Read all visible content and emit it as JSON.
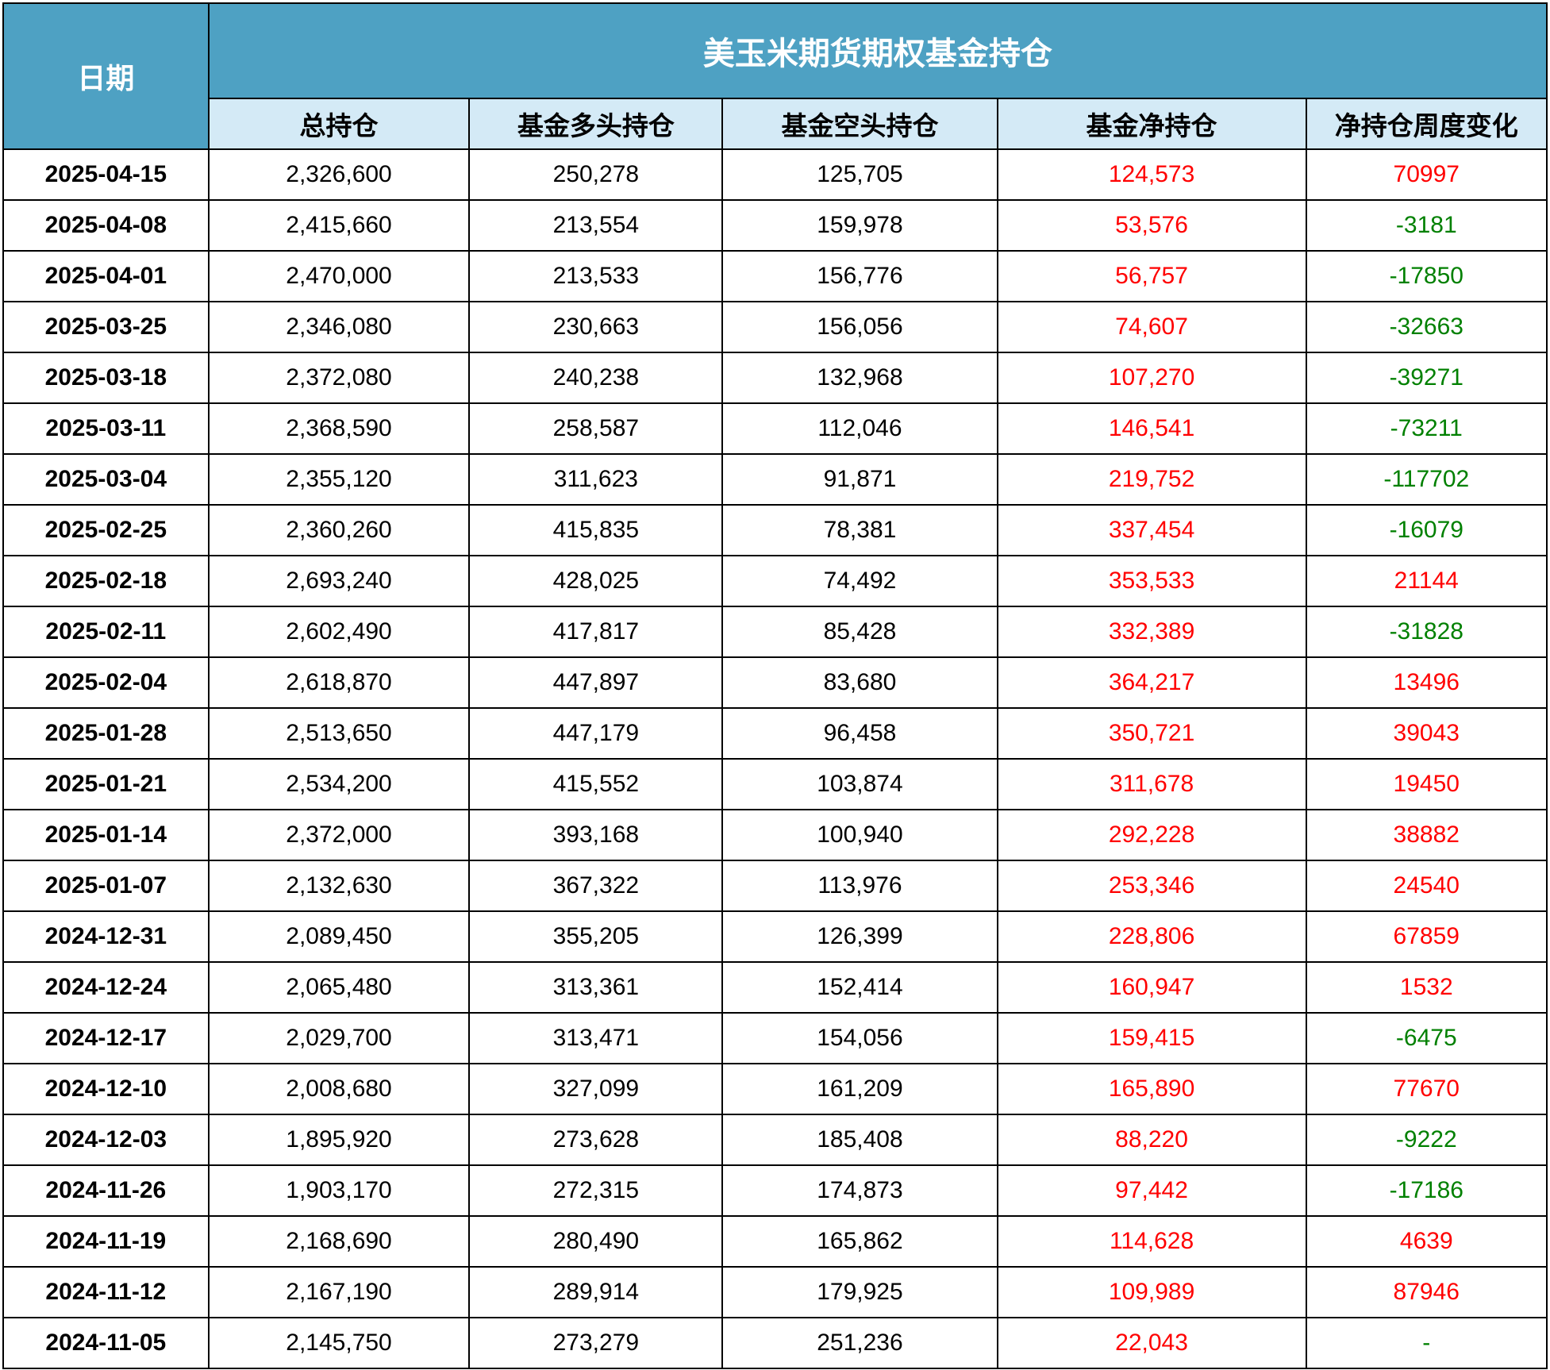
{
  "table": {
    "date_header": "日期",
    "title": "美玉米期货期权基金持仓",
    "columns": [
      "总持仓",
      "基金多头持仓",
      "基金空头持仓",
      "基金净持仓",
      "净持仓周度变化"
    ],
    "rows": [
      {
        "date": "2025-04-15",
        "total": "2,326,600",
        "long": "250,278",
        "short": "125,705",
        "net": "124,573",
        "change": "70997"
      },
      {
        "date": "2025-04-08",
        "total": "2,415,660",
        "long": "213,554",
        "short": "159,978",
        "net": "53,576",
        "change": "-3181"
      },
      {
        "date": "2025-04-01",
        "total": "2,470,000",
        "long": "213,533",
        "short": "156,776",
        "net": "56,757",
        "change": "-17850"
      },
      {
        "date": "2025-03-25",
        "total": "2,346,080",
        "long": "230,663",
        "short": "156,056",
        "net": "74,607",
        "change": "-32663"
      },
      {
        "date": "2025-03-18",
        "total": "2,372,080",
        "long": "240,238",
        "short": "132,968",
        "net": "107,270",
        "change": "-39271"
      },
      {
        "date": "2025-03-11",
        "total": "2,368,590",
        "long": "258,587",
        "short": "112,046",
        "net": "146,541",
        "change": "-73211"
      },
      {
        "date": "2025-03-04",
        "total": "2,355,120",
        "long": "311,623",
        "short": "91,871",
        "net": "219,752",
        "change": "-117702"
      },
      {
        "date": "2025-02-25",
        "total": "2,360,260",
        "long": "415,835",
        "short": "78,381",
        "net": "337,454",
        "change": "-16079"
      },
      {
        "date": "2025-02-18",
        "total": "2,693,240",
        "long": "428,025",
        "short": "74,492",
        "net": "353,533",
        "change": "21144"
      },
      {
        "date": "2025-02-11",
        "total": "2,602,490",
        "long": "417,817",
        "short": "85,428",
        "net": "332,389",
        "change": "-31828"
      },
      {
        "date": "2025-02-04",
        "total": "2,618,870",
        "long": "447,897",
        "short": "83,680",
        "net": "364,217",
        "change": "13496"
      },
      {
        "date": "2025-01-28",
        "total": "2,513,650",
        "long": "447,179",
        "short": "96,458",
        "net": "350,721",
        "change": "39043"
      },
      {
        "date": "2025-01-21",
        "total": "2,534,200",
        "long": "415,552",
        "short": "103,874",
        "net": "311,678",
        "change": "19450"
      },
      {
        "date": "2025-01-14",
        "total": "2,372,000",
        "long": "393,168",
        "short": "100,940",
        "net": "292,228",
        "change": "38882"
      },
      {
        "date": "2025-01-07",
        "total": "2,132,630",
        "long": "367,322",
        "short": "113,976",
        "net": "253,346",
        "change": "24540"
      },
      {
        "date": "2024-12-31",
        "total": "2,089,450",
        "long": "355,205",
        "short": "126,399",
        "net": "228,806",
        "change": "67859"
      },
      {
        "date": "2024-12-24",
        "total": "2,065,480",
        "long": "313,361",
        "short": "152,414",
        "net": "160,947",
        "change": "1532"
      },
      {
        "date": "2024-12-17",
        "total": "2,029,700",
        "long": "313,471",
        "short": "154,056",
        "net": "159,415",
        "change": "-6475"
      },
      {
        "date": "2024-12-10",
        "total": "2,008,680",
        "long": "327,099",
        "short": "161,209",
        "net": "165,890",
        "change": "77670"
      },
      {
        "date": "2024-12-03",
        "total": "1,895,920",
        "long": "273,628",
        "short": "185,408",
        "net": "88,220",
        "change": "-9222"
      },
      {
        "date": "2024-11-26",
        "total": "1,903,170",
        "long": "272,315",
        "short": "174,873",
        "net": "97,442",
        "change": "-17186"
      },
      {
        "date": "2024-11-19",
        "total": "2,168,690",
        "long": "280,490",
        "short": "165,862",
        "net": "114,628",
        "change": "4639"
      },
      {
        "date": "2024-11-12",
        "total": "2,167,190",
        "long": "289,914",
        "short": "179,925",
        "net": "109,989",
        "change": "87946"
      },
      {
        "date": "2024-11-05",
        "total": "2,145,750",
        "long": "273,279",
        "short": "251,236",
        "net": "22,043",
        "change": "-"
      }
    ]
  },
  "colors": {
    "header_blue": "#4EA1C3",
    "subheader_blue": "#D4EAF6",
    "positive_red": "#FF0000",
    "negative_green": "#008000",
    "grid_black": "#000000"
  }
}
